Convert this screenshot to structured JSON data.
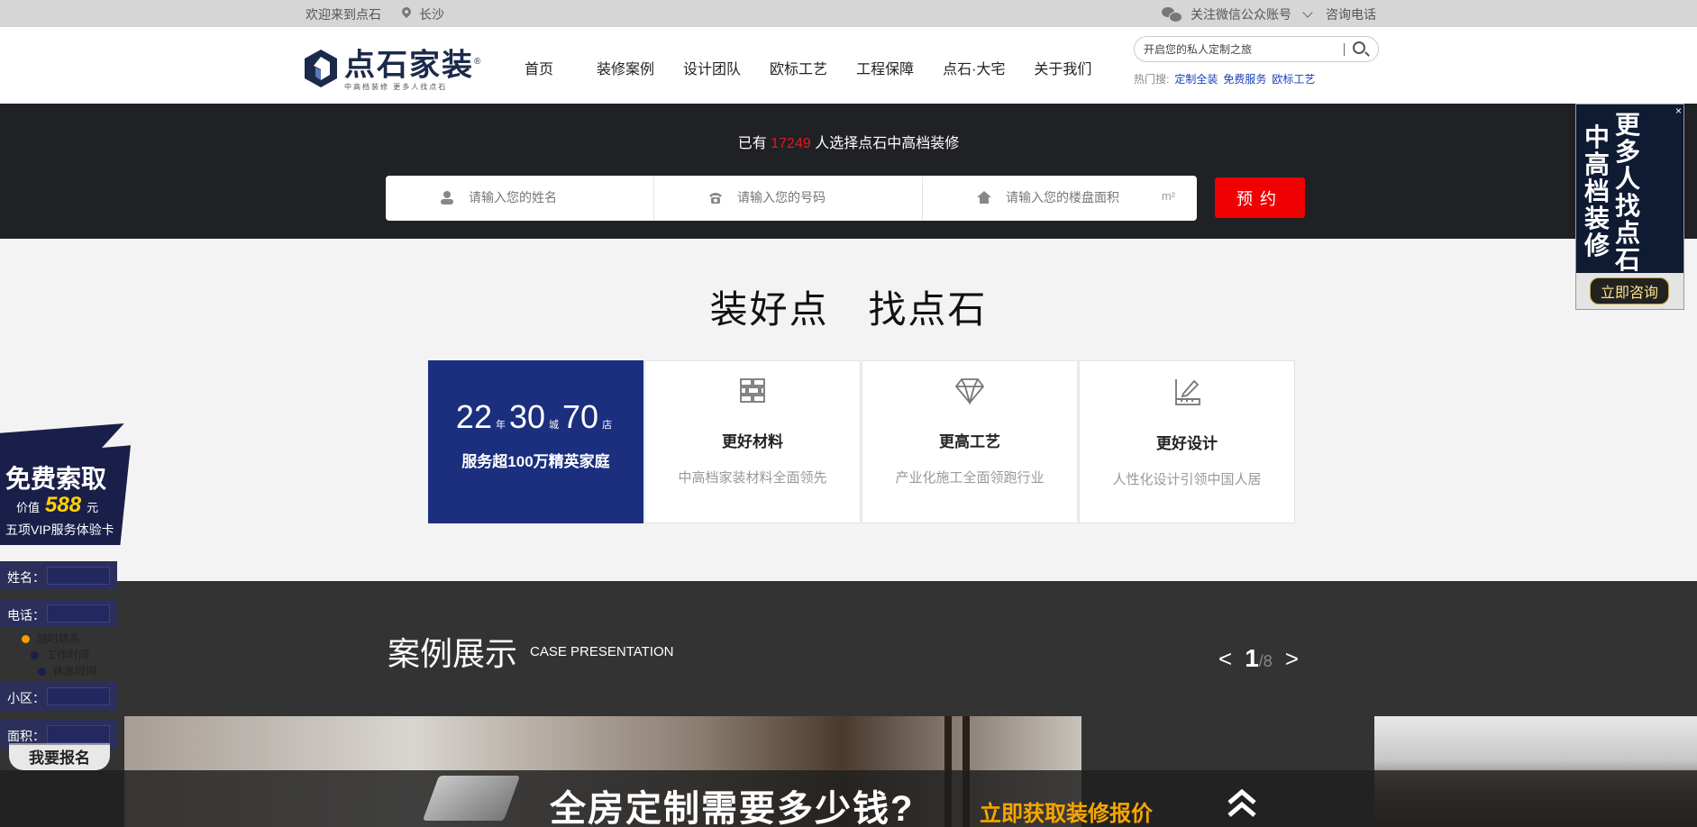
{
  "topbar": {
    "welcome": "欢迎来到点石",
    "city": "长沙",
    "wechat": "关注微信公众账号",
    "phone": "咨询电话"
  },
  "logo": {
    "name": "点石家装",
    "reg": "®",
    "slogan": "中高档装修 更多人找点石"
  },
  "nav": [
    "首页",
    "装修案例",
    "设计团队",
    "欧标工艺",
    "工程保障",
    "点石·大宅",
    "关于我们"
  ],
  "search": {
    "placeholder": "开启您的私人定制之旅",
    "hot_label": "热门搜:",
    "hot": [
      "定制全装",
      "免费服务",
      "欧标工艺"
    ]
  },
  "appointment": {
    "prefix": "已有",
    "count": "17249",
    "suffix": "人选择点石中高档装修",
    "name_placeholder": "请输入您的姓名",
    "phone_placeholder": "请输入您的号码",
    "area_placeholder": "请输入您的楼盘面积",
    "area_unit": "m²",
    "button": "预约"
  },
  "right_float": {
    "close": "×",
    "col1": "中高档装修",
    "col2": "更多人找点石",
    "button": "立即咨询"
  },
  "slogan": "装好点 找点石",
  "stats": {
    "years": "22",
    "years_unit": "年",
    "cities": "30",
    "cities_unit": "城",
    "stores": "70",
    "stores_unit": "店",
    "served": "服务超100万精英家庭"
  },
  "features": [
    {
      "icon": "bricks-icon",
      "title": "更好材料",
      "desc": "中高档家装材料全面领先"
    },
    {
      "icon": "diamond-icon",
      "title": "更高工艺",
      "desc": "产业化施工全面领跑行业"
    },
    {
      "icon": "design-ruler-icon",
      "title": "更好设计",
      "desc": "人性化设计引领中国人居"
    }
  ],
  "cases": {
    "title": "案例展示",
    "subtitle": "CASE PRESENTATION",
    "page_current": "1",
    "page_total": "/8",
    "prev": "<",
    "next": ">"
  },
  "banner": {
    "question": "全房定制需要多少钱?",
    "cta": "立即获取装修报价"
  },
  "left_float": {
    "free": "免费索取",
    "value_prefix": "价值",
    "value": "588",
    "value_unit": "元",
    "vip": "五项VIP服务体验卡",
    "name_label": "姓名：",
    "phone_label": "电话：",
    "opt1": "随时联系",
    "opt2": "工作时间",
    "opt3": "休息时间",
    "estate_label": "小区：",
    "area_label": "面积：",
    "signup": "我要报名"
  },
  "colors": {
    "accent_red": "#f00000",
    "navy": "#1b2f7e",
    "dark_band": "#202125",
    "hot_link": "#1a3fb8",
    "cta_orange": "#f7a600"
  }
}
